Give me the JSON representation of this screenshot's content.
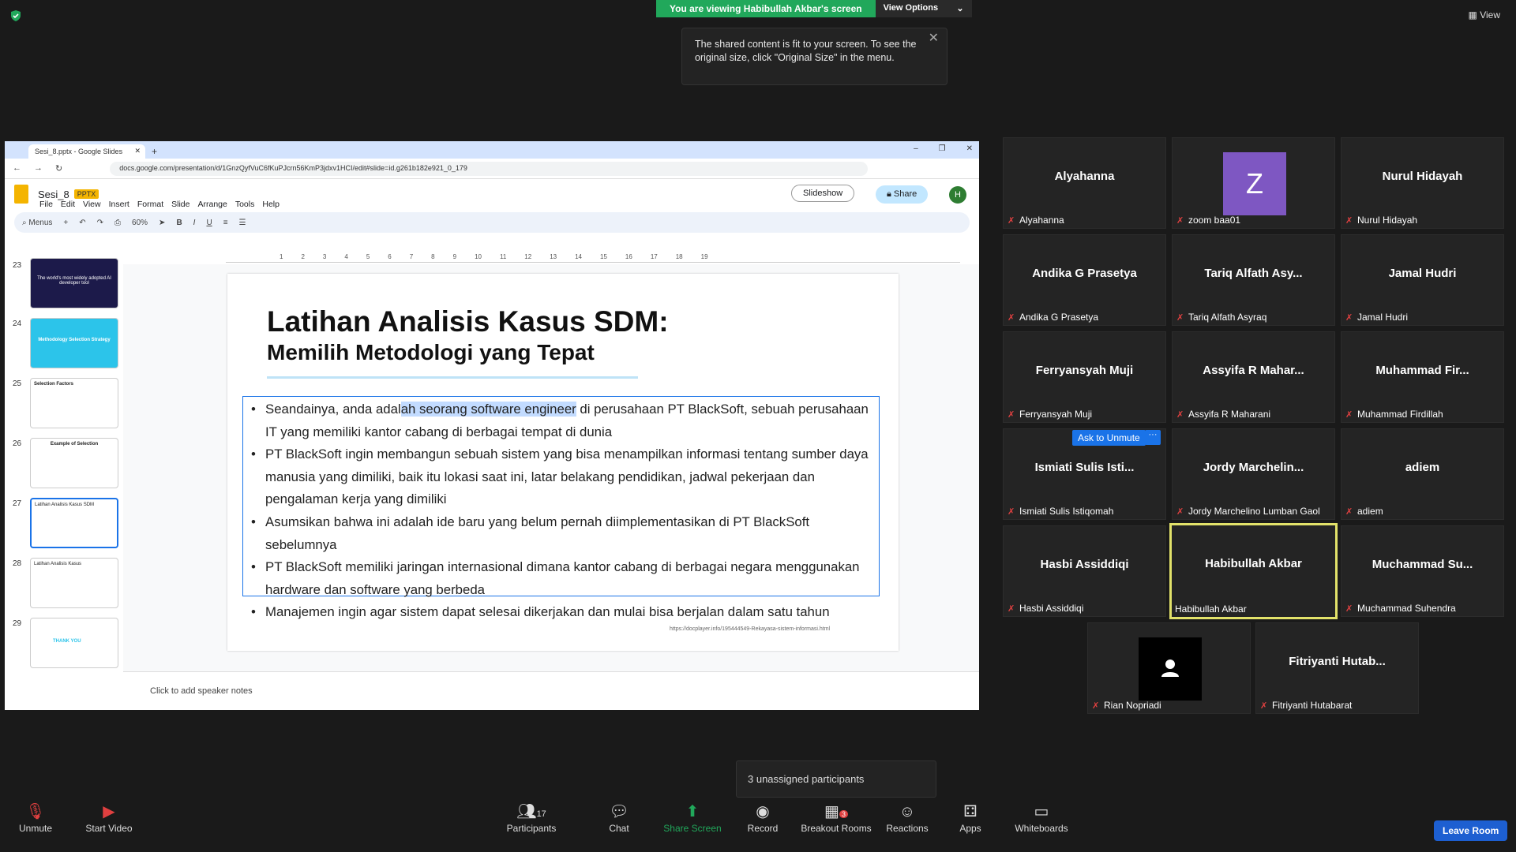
{
  "banner": {
    "viewing": "You are viewing Habibullah Akbar's screen",
    "view_options": "View Options"
  },
  "tooltip": "The shared content is fit to your screen. To see the original size, click \"Original Size\" in the menu.",
  "top_right": {
    "view": "View"
  },
  "browser": {
    "tab_title": "Sesi_8.pptx - Google Slides",
    "url": "docs.google.com/presentation/d/1GnzQyfVuC6fKuPJcrn56KmP3jdxv1HCI/edit#slide=id.g261b182e921_0_179"
  },
  "doc": {
    "name": "Sesi_8",
    "badge": "PPTX",
    "menu": [
      "File",
      "Edit",
      "View",
      "Insert",
      "Format",
      "Slide",
      "Arrange",
      "Tools",
      "Help"
    ],
    "slideshow": "Slideshow",
    "share": "Share",
    "avatar": "H",
    "toolbar_menus": "Menus",
    "zoom": "60%"
  },
  "ruler": [
    "1",
    "2",
    "3",
    "4",
    "5",
    "6",
    "7",
    "8",
    "9",
    "10",
    "11",
    "12",
    "13",
    "14",
    "15",
    "16",
    "17",
    "18",
    "19"
  ],
  "thumbnails": [
    {
      "num": "23",
      "text": "The world's most widely adopted AI developer tool"
    },
    {
      "num": "24",
      "text": "Methodology Selection Strategy"
    },
    {
      "num": "25",
      "text": "Selection Factors"
    },
    {
      "num": "26",
      "text": "Example of Selection"
    },
    {
      "num": "27",
      "text": "Latihan Analisis Kasus SDM"
    },
    {
      "num": "28",
      "text": "Latihan Analisis Kasus"
    },
    {
      "num": "29",
      "text": "THANK YOU"
    }
  ],
  "slide": {
    "title": "Latihan Analisis Kasus SDM:",
    "subtitle": "Memilih Metodologi yang Tepat",
    "b1_pre": "Seandainya, anda adal",
    "b1_hl": "ah seorang software engineer",
    "b1_post": " di perusahaan PT BlackSoft, sebuah perusahaan IT yang memiliki kantor cabang di berbagai tempat di dunia",
    "b2": "PT BlackSoft ingin membangun sebuah sistem yang bisa menampilkan informasi tentang sumber daya manusia yang dimiliki, baik itu lokasi saat ini, latar belakang pendidikan, jadwal pekerjaan dan pengalaman kerja yang dimiliki",
    "b3": "Asumsikan bahwa ini adalah ide baru yang belum pernah diimplementasikan di PT BlackSoft sebelumnya",
    "b4": "PT BlackSoft memiliki jaringan internasional dimana kantor cabang di berbagai negara menggunakan hardware dan software yang berbeda",
    "b5": "Manajemen ingin agar sistem dapat selesai dikerjakan dan mulai bisa berjalan dalam satu tahun",
    "source": "https://docplayer.info/195444549-Rekayasa-sistem-informasi.html"
  },
  "notes": "Click to add speaker notes",
  "participants": [
    {
      "name": "Alyahanna",
      "label": "Alyahanna"
    },
    {
      "name": "Z",
      "label": "zoom baa01"
    },
    {
      "name": "Nurul Hidayah",
      "label": "Nurul Hidayah"
    },
    {
      "name": "Andika G Prasetya",
      "label": "Andika G Prasetya"
    },
    {
      "name": "Tariq Alfath Asy...",
      "label": "Tariq Alfath Asyraq"
    },
    {
      "name": "Jamal Hudri",
      "label": "Jamal Hudri"
    },
    {
      "name": "Ferryansyah Muji",
      "label": "Ferryansyah Muji"
    },
    {
      "name": "Assyifa R Mahar...",
      "label": "Assyifa R Maharani"
    },
    {
      "name": "Muhammad  Fir...",
      "label": "Muhammad Firdillah"
    },
    {
      "name": "Ismiati Sulis Isti...",
      "label": "Ismiati Sulis Istiqomah"
    },
    {
      "name": "Jordy  Marchelin...",
      "label": "Jordy Marchelino Lumban Gaol"
    },
    {
      "name": "adiem",
      "label": "adiem"
    },
    {
      "name": "Hasbi Assiddiqi",
      "label": "Hasbi Assiddiqi"
    },
    {
      "name": "Habibullah Akbar",
      "label": "Habibullah Akbar"
    },
    {
      "name": "Muchammad  Su...",
      "label": "Muchammad Suhendra"
    },
    {
      "name": "",
      "label": "Rian Nopriadi"
    },
    {
      "name": "Fitriyanti  Hutab...",
      "label": "Fitriyanti Hutabarat"
    }
  ],
  "ask_unmute": "Ask to Unmute",
  "ask_more": "···",
  "unassigned": "3 unassigned participants",
  "bottom": {
    "unmute": "Unmute",
    "start_video": "Start Video",
    "participants": "Participants",
    "participants_count": "17",
    "chat": "Chat",
    "share_screen": "Share Screen",
    "record": "Record",
    "breakout": "Breakout Rooms",
    "breakout_badge": "3",
    "reactions": "Reactions",
    "apps": "Apps",
    "whiteboards": "Whiteboards",
    "leave": "Leave Room"
  },
  "colors": {
    "zoom_green": "#21a85b",
    "zoom_blue": "#1d5fd1",
    "active_speaker": "#e2e26a",
    "docs_blue": "#1a73e8"
  }
}
